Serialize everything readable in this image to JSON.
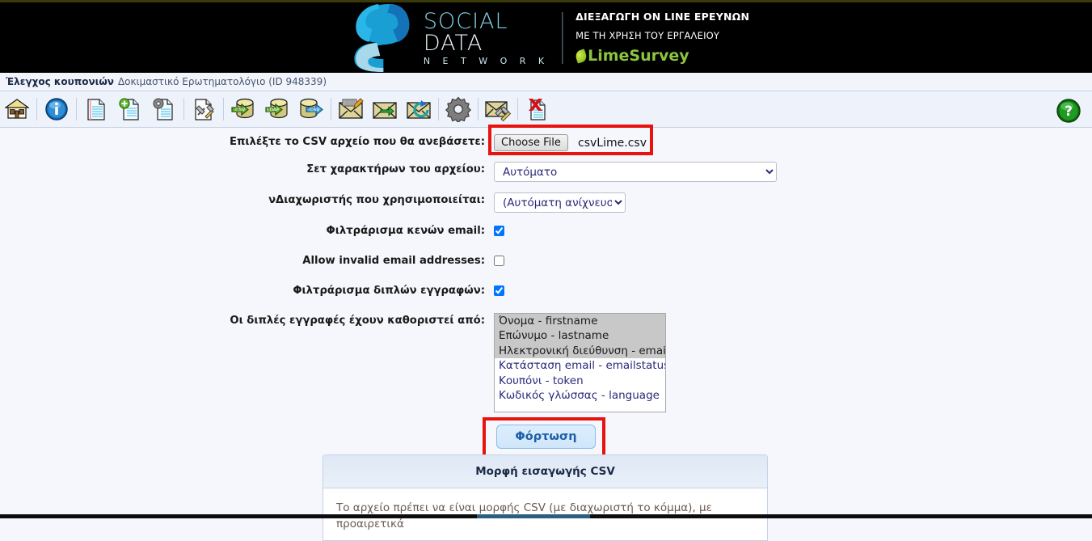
{
  "banner": {
    "logo_line1": "SOCIAL",
    "logo_line2": "DATA",
    "logo_line3": "N E T W O R K",
    "tagline_line1": "ΔΙΕΞΑΓΩΓΗ ΟN LINE ΕΡΕΥΝΩΝ",
    "tagline_line2": "ΜΕ ΤΗ ΧΡΗΣΗ ΤΟΥ ΕΡΓΑΛΕΙΟΥ",
    "product": "LimeSurvey",
    "bg_color": "#000000"
  },
  "titlebar": {
    "section": "Έλεγχος κουπονιών",
    "survey": "Δοκιμαστικό Ερωτηματολόγιο (ID 948339)"
  },
  "toolbar": {
    "items": [
      {
        "name": "home-icon",
        "title": "Αρχική"
      },
      {
        "name": "info-icon",
        "title": "Πληροφορίες"
      },
      {
        "name": "document-icon",
        "title": "Εμφάνιση κουπονιών"
      },
      {
        "name": "document-add-icon",
        "title": "Προσθήκη κουπονιού"
      },
      {
        "name": "document-settings-icon",
        "title": "Διαχείριση χαρακτηριστικών"
      },
      {
        "name": "document-tools-icon",
        "title": "Δημιουργία κουπονιών"
      },
      {
        "name": "database-csv-import-icon",
        "title": "Εισαγωγή από CSV"
      },
      {
        "name": "database-ldap-import-icon",
        "title": "Εισαγωγή από LDAP"
      },
      {
        "name": "database-csv-export-icon",
        "title": "Εξαγωγή σε CSV"
      },
      {
        "name": "envelope-edit-icon",
        "title": "Πρόσκληση"
      },
      {
        "name": "envelope-send-icon",
        "title": "Αποστολή προσκλήσεων"
      },
      {
        "name": "envelope-reminder-icon",
        "title": "Αποστολή υπενθυμίσεων"
      },
      {
        "name": "gear-icon",
        "title": "Ρυθμίσεις"
      },
      {
        "name": "envelope-tools-icon",
        "title": "Επεξεργασία προτύπων email"
      },
      {
        "name": "document-delete-icon",
        "title": "Διαγραφή πίνακα κουπονιών"
      }
    ],
    "help": {
      "name": "help-icon",
      "glyph": "?"
    }
  },
  "form": {
    "file_label": "Επιλέξτε το CSV αρχείο που θα ανεβάσετε:",
    "choose_file_button": "Choose File",
    "chosen_file": "csvLime.csv",
    "charset_label": "Σετ χαρακτήρων του αρχείου:",
    "charset_value": "Αυτόματο",
    "separator_label": "νΔιαχωριστής που χρησιμοποιείται:",
    "separator_value": "(Αυτόματη ανίχνευση)",
    "filter_blank_label": "Φιλτράρισμα κενών email:",
    "filter_blank_checked": true,
    "allow_invalid_label": "Allow invalid email addresses:",
    "allow_invalid_checked": false,
    "filter_dupes_label": "Φιλτράρισμα διπλών εγγραφών:",
    "filter_dupes_checked": true,
    "dupes_by_label": "Οι διπλές εγγραφές έχουν καθοριστεί από:",
    "dupes_options": [
      {
        "label": "Όνομα - firstname",
        "selected": true
      },
      {
        "label": "Επώνυμο - lastname",
        "selected": true
      },
      {
        "label": "Ηλεκτρονική διεύθυνση - email",
        "selected": true
      },
      {
        "label": "Κατάσταση email - emailstatus",
        "selected": false
      },
      {
        "label": "Κουπόνι - token",
        "selected": false
      },
      {
        "label": "Κωδικός γλώσσας - language",
        "selected": false
      }
    ],
    "submit_label": "Φόρτωση"
  },
  "info_panel": {
    "title": "Μορφή εισαγωγής CSV",
    "body": "Το αρχείο πρέπει να είναι μορφής CSV (με διαχωριστή το κόμμα), με προαιρετικά"
  },
  "annotations": {
    "highlight_color": "#e8120e"
  }
}
